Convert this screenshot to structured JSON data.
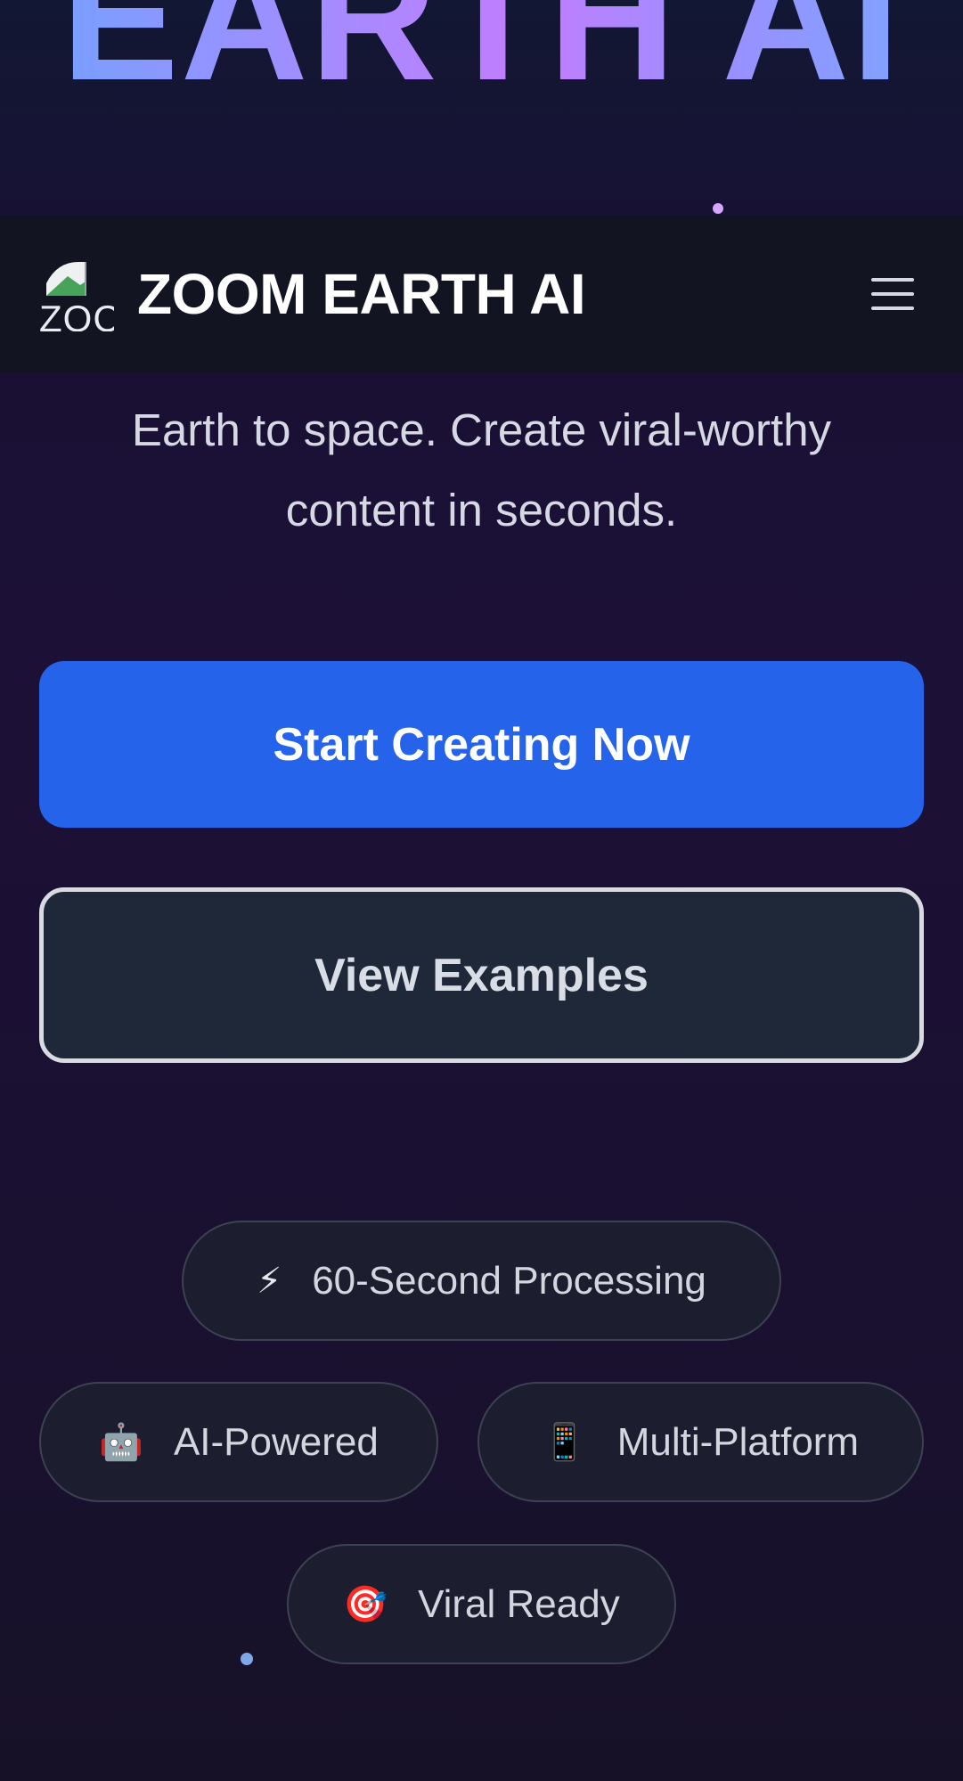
{
  "hero": {
    "title": "EARTH AI"
  },
  "navbar": {
    "logo_alt": "ZOC",
    "brand": "ZOOM EARTH AI",
    "menu_icon": "hamburger-menu-icon"
  },
  "subtitle": "Earth to space. Create viral-worthy content in seconds.",
  "buttons": {
    "primary": "Start Creating Now",
    "secondary": "View Examples"
  },
  "features": [
    {
      "icon": "⚡",
      "icon_name": "lightning-icon",
      "label": "60-Second Processing"
    },
    {
      "icon": "🤖",
      "icon_name": "robot-icon",
      "label": "AI-Powered"
    },
    {
      "icon": "📱",
      "icon_name": "mobile-phone-icon",
      "label": "Multi-Platform"
    },
    {
      "icon": "🎯",
      "icon_name": "target-icon",
      "label": "Viral Ready"
    }
  ],
  "colors": {
    "primary_button": "#2563eb",
    "secondary_button": "#1f2838",
    "navbar": "#121620",
    "background": "#1c1036"
  }
}
